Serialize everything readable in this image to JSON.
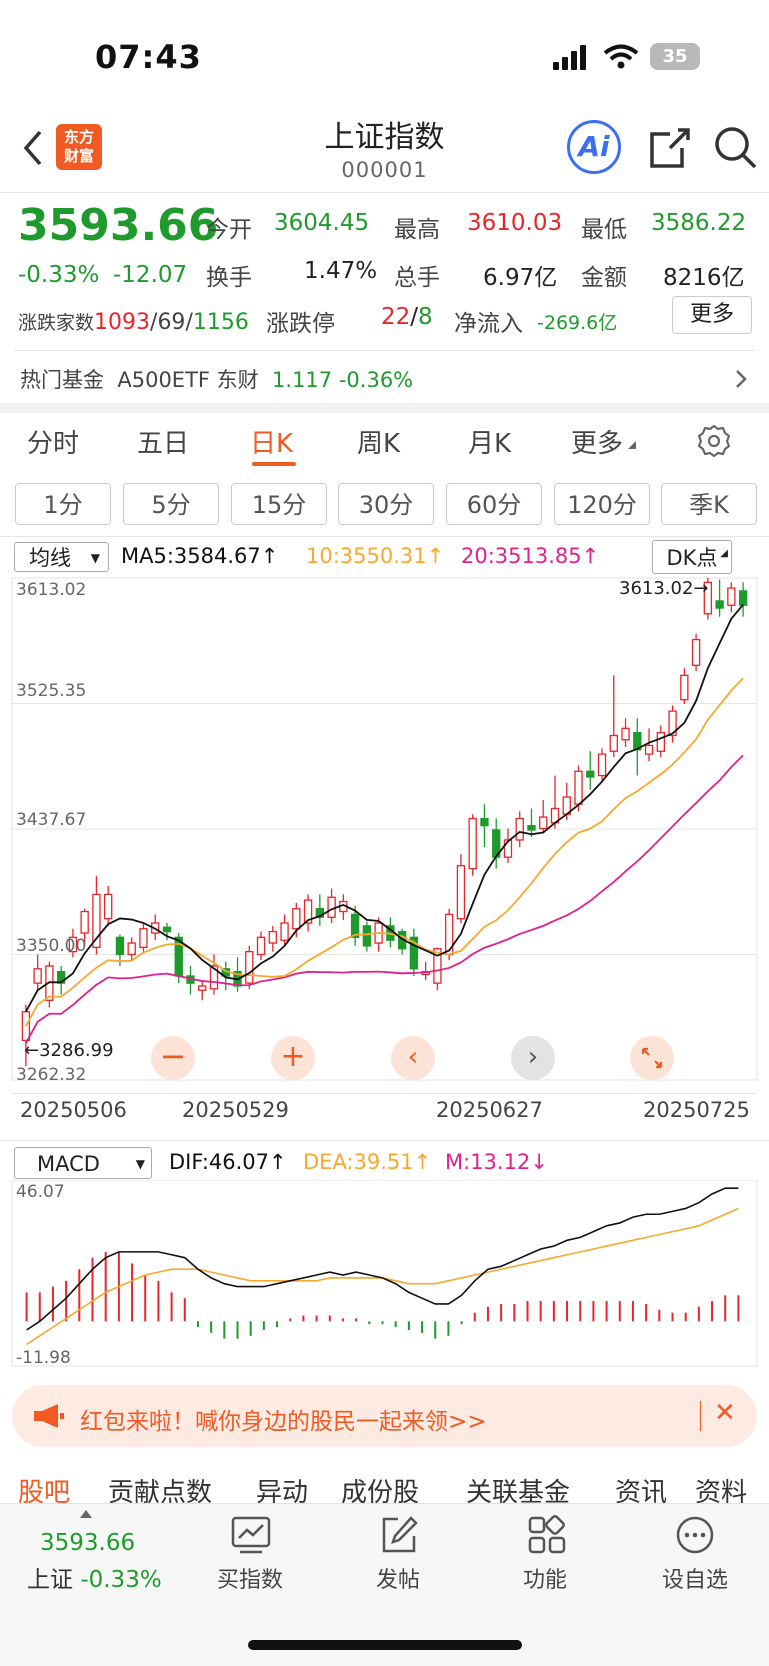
{
  "status_bar": {
    "time": "07:43",
    "battery": "35"
  },
  "header": {
    "logo_text": "东方\n财富",
    "title": "上证指数",
    "code": "000001"
  },
  "quote": {
    "price": "3593.66",
    "change_pct": "-0.33%",
    "change": "-12.07",
    "open_label": "今开",
    "open": "3604.45",
    "high_label": "最高",
    "high": "3610.03",
    "low_label": "最低",
    "low": "3586.22",
    "turnover_label": "换手",
    "turnover": "1.47%",
    "volume_label": "总手",
    "volume": "6.97亿",
    "amount_label": "金额",
    "amount": "8216亿",
    "breadth_label": "涨跌家数",
    "breadth_up": "1093",
    "breadth_flat": "69",
    "breadth_down": "1156",
    "limit_label": "涨跌停",
    "limit_up": "22",
    "limit_down": "8",
    "netflow_label": "净流入",
    "netflow": "-269.6亿",
    "more_label": "更多"
  },
  "hot_fund": {
    "label": "热门基金",
    "name": "A500ETF 东财",
    "price": "1.117",
    "change": "-0.36%"
  },
  "tabs": [
    "分时",
    "五日",
    "日K",
    "周K",
    "月K",
    "更多"
  ],
  "active_tab": "日K",
  "periods": [
    "1分",
    "5分",
    "15分",
    "30分",
    "60分",
    "120分",
    "季K"
  ],
  "ma_bar": {
    "selector": "均线",
    "ma5": "MA5:3584.67↑",
    "ma10": "10:3550.31↑",
    "ma20": "20:3513.85↑",
    "dk": "DK点"
  },
  "colors": {
    "up": "#e5262a",
    "down": "#1f9a2c",
    "ma5": "#111111",
    "ma10": "#f7a82f",
    "ma20": "#e0208c",
    "accent": "#f15a22"
  },
  "chart_data": [
    {
      "type": "candlestick",
      "title": "上证指数 日K",
      "y_ticks": [
        "3613.02",
        "3525.35",
        "3437.67",
        "3350.00",
        "3262.32"
      ],
      "ylim": [
        3262.32,
        3613.02
      ],
      "x_ticks": [
        "20250506",
        "20250529",
        "20250627",
        "20250725"
      ],
      "high_marker": "3613.02→",
      "low_marker": "←3286.99",
      "candles": [
        {
          "o": 3290,
          "c": 3310,
          "h": 3315,
          "l": 3272
        },
        {
          "o": 3330,
          "c": 3340,
          "h": 3350,
          "l": 3325
        },
        {
          "o": 3318,
          "c": 3342,
          "h": 3345,
          "l": 3313
        },
        {
          "o": 3338,
          "c": 3330,
          "h": 3342,
          "l": 3322
        },
        {
          "o": 3352,
          "c": 3362,
          "h": 3368,
          "l": 3348
        },
        {
          "o": 3365,
          "c": 3380,
          "h": 3382,
          "l": 3357
        },
        {
          "o": 3355,
          "c": 3392,
          "h": 3405,
          "l": 3350
        },
        {
          "o": 3375,
          "c": 3392,
          "h": 3398,
          "l": 3370
        },
        {
          "o": 3362,
          "c": 3350,
          "h": 3364,
          "l": 3342
        },
        {
          "o": 3350,
          "c": 3358,
          "h": 3362,
          "l": 3345
        },
        {
          "o": 3355,
          "c": 3368,
          "h": 3372,
          "l": 3352
        },
        {
          "o": 3365,
          "c": 3372,
          "h": 3378,
          "l": 3360
        },
        {
          "o": 3369,
          "c": 3366,
          "h": 3372,
          "l": 3360
        },
        {
          "o": 3362,
          "c": 3335,
          "h": 3365,
          "l": 3330
        },
        {
          "o": 3335,
          "c": 3330,
          "h": 3342,
          "l": 3322
        },
        {
          "o": 3325,
          "c": 3328,
          "h": 3332,
          "l": 3318
        },
        {
          "o": 3326,
          "c": 3342,
          "h": 3350,
          "l": 3322
        },
        {
          "o": 3340,
          "c": 3335,
          "h": 3345,
          "l": 3325
        },
        {
          "o": 3338,
          "c": 3328,
          "h": 3348,
          "l": 3324
        },
        {
          "o": 3330,
          "c": 3352,
          "h": 3356,
          "l": 3326
        },
        {
          "o": 3350,
          "c": 3362,
          "h": 3366,
          "l": 3346
        },
        {
          "o": 3358,
          "c": 3366,
          "h": 3370,
          "l": 3352
        },
        {
          "o": 3360,
          "c": 3372,
          "h": 3378,
          "l": 3356
        },
        {
          "o": 3368,
          "c": 3382,
          "h": 3386,
          "l": 3362
        },
        {
          "o": 3372,
          "c": 3388,
          "h": 3392,
          "l": 3366
        },
        {
          "o": 3382,
          "c": 3376,
          "h": 3392,
          "l": 3370
        },
        {
          "o": 3376,
          "c": 3390,
          "h": 3396,
          "l": 3372
        },
        {
          "o": 3380,
          "c": 3387,
          "h": 3392,
          "l": 3374
        },
        {
          "o": 3378,
          "c": 3362,
          "h": 3384,
          "l": 3356
        },
        {
          "o": 3370,
          "c": 3356,
          "h": 3373,
          "l": 3352
        },
        {
          "o": 3358,
          "c": 3372,
          "h": 3376,
          "l": 3352
        },
        {
          "o": 3370,
          "c": 3360,
          "h": 3376,
          "l": 3355
        },
        {
          "o": 3366,
          "c": 3354,
          "h": 3368,
          "l": 3350
        },
        {
          "o": 3362,
          "c": 3340,
          "h": 3368,
          "l": 3335
        },
        {
          "o": 3336,
          "c": 3338,
          "h": 3345,
          "l": 3332
        },
        {
          "o": 3330,
          "c": 3354,
          "h": 3355,
          "l": 3325
        },
        {
          "o": 3350,
          "c": 3378,
          "h": 3382,
          "l": 3346
        },
        {
          "o": 3375,
          "c": 3412,
          "h": 3420,
          "l": 3372
        },
        {
          "o": 3410,
          "c": 3445,
          "h": 3448,
          "l": 3405
        },
        {
          "o": 3445,
          "c": 3440,
          "h": 3455,
          "l": 3425
        },
        {
          "o": 3437,
          "c": 3418,
          "h": 3445,
          "l": 3410
        },
        {
          "o": 3418,
          "c": 3430,
          "h": 3438,
          "l": 3414
        },
        {
          "o": 3430,
          "c": 3445,
          "h": 3450,
          "l": 3425
        },
        {
          "o": 3440,
          "c": 3437,
          "h": 3452,
          "l": 3432
        },
        {
          "o": 3438,
          "c": 3446,
          "h": 3458,
          "l": 3435
        },
        {
          "o": 3442,
          "c": 3452,
          "h": 3475,
          "l": 3438
        },
        {
          "o": 3448,
          "c": 3460,
          "h": 3470,
          "l": 3444
        },
        {
          "o": 3455,
          "c": 3478,
          "h": 3482,
          "l": 3450
        },
        {
          "o": 3478,
          "c": 3474,
          "h": 3492,
          "l": 3465
        },
        {
          "o": 3475,
          "c": 3490,
          "h": 3494,
          "l": 3470
        },
        {
          "o": 3492,
          "c": 3503,
          "h": 3545,
          "l": 3488
        },
        {
          "o": 3500,
          "c": 3508,
          "h": 3515,
          "l": 3495
        },
        {
          "o": 3505,
          "c": 3493,
          "h": 3515,
          "l": 3475
        },
        {
          "o": 3490,
          "c": 3496,
          "h": 3508,
          "l": 3485
        },
        {
          "o": 3492,
          "c": 3505,
          "h": 3510,
          "l": 3488
        },
        {
          "o": 3503,
          "c": 3520,
          "h": 3524,
          "l": 3498
        },
        {
          "o": 3528,
          "c": 3545,
          "h": 3550,
          "l": 3525
        },
        {
          "o": 3552,
          "c": 3570,
          "h": 3574,
          "l": 3548
        },
        {
          "o": 3588,
          "c": 3610,
          "h": 3613,
          "l": 3584
        },
        {
          "o": 3597,
          "c": 3592,
          "h": 3612,
          "l": 3586
        },
        {
          "o": 3594,
          "c": 3606,
          "h": 3610,
          "l": 3589
        },
        {
          "o": 3604,
          "c": 3594,
          "h": 3610,
          "l": 3586
        }
      ]
    },
    {
      "type": "bar",
      "title": "MACD",
      "y_ticks": [
        "46.07",
        "-11.98"
      ],
      "ylim": [
        -11.98,
        46.07
      ],
      "series_names": [
        "DIF",
        "DEA",
        "M"
      ],
      "dif": [
        -3,
        0,
        4,
        8,
        13,
        18,
        22,
        24,
        24,
        24,
        24,
        23,
        22,
        18,
        15,
        13,
        12,
        12,
        12,
        13,
        14,
        15,
        16,
        17,
        16,
        17,
        16,
        15,
        13,
        10,
        8,
        6,
        6,
        9,
        14,
        18,
        19,
        21,
        23,
        25,
        26,
        28,
        29,
        31,
        33,
        34,
        36,
        37,
        37,
        38,
        39,
        41,
        44,
        46,
        46
      ],
      "dea": [
        -8,
        -5,
        -2,
        1,
        4,
        7,
        10,
        12,
        14,
        16,
        17,
        18,
        18,
        18,
        17,
        16,
        15,
        14,
        14,
        14,
        14,
        14,
        14,
        15,
        15,
        15,
        15,
        15,
        14,
        13,
        13,
        13,
        14,
        15,
        16,
        17,
        18,
        19,
        20,
        21,
        22,
        23,
        24,
        25,
        26,
        27,
        28,
        29,
        30,
        31,
        32,
        33,
        35,
        37,
        39
      ],
      "m": [
        10,
        10,
        12,
        14,
        18,
        22,
        24,
        24,
        20,
        16,
        14,
        10,
        8,
        -2,
        -4,
        -6,
        -6,
        -5,
        -3,
        -2,
        1,
        2,
        2,
        2,
        1,
        1,
        -1,
        -1,
        -2,
        -3,
        -4,
        -6,
        -5,
        -1,
        3,
        5,
        6,
        6,
        7,
        7,
        7,
        7,
        7,
        7,
        7,
        7,
        7,
        6,
        4,
        3,
        3,
        5,
        7,
        9,
        9
      ]
    }
  ],
  "macd_bar": {
    "selector": "MACD",
    "dif": "DIF:46.07↑",
    "dea": "DEA:39.51↑",
    "m": "M:13.12↓"
  },
  "banner": {
    "text": "红包来啦！喊你身边的股民一起来领>>",
    "close": "✕"
  },
  "bottom_tabs": [
    "股吧",
    "贡献点数",
    "异动",
    "成份股",
    "关联基金",
    "资讯",
    "资料"
  ],
  "bottom_bar": {
    "price": "3593.66",
    "name": "上证",
    "change": "-0.33%",
    "items": [
      "买指数",
      "发帖",
      "功能",
      "设自选"
    ]
  }
}
